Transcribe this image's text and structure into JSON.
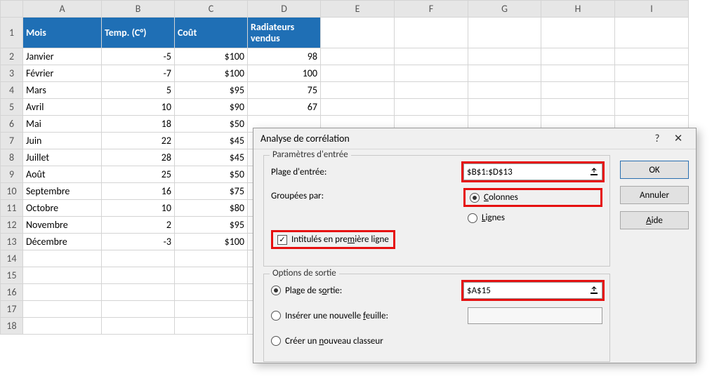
{
  "columns": [
    "A",
    "B",
    "C",
    "D",
    "E",
    "F",
    "G",
    "H",
    "I"
  ],
  "header": {
    "mois": "Mois",
    "temp": "Temp. (C°)",
    "cout": "Coût",
    "rad": "Radiateurs vendus"
  },
  "rows": [
    {
      "n": 2,
      "mois": "Janvier",
      "temp": "-5",
      "cout": "$100",
      "rad": "98"
    },
    {
      "n": 3,
      "mois": "Février",
      "temp": "-7",
      "cout": "$100",
      "rad": "100"
    },
    {
      "n": 4,
      "mois": "Mars",
      "temp": "5",
      "cout": "$95",
      "rad": "75"
    },
    {
      "n": 5,
      "mois": "Avril",
      "temp": "10",
      "cout": "$90",
      "rad": "67"
    },
    {
      "n": 6,
      "mois": "Mai",
      "temp": "18",
      "cout": "$50",
      "rad": ""
    },
    {
      "n": 7,
      "mois": "Juin",
      "temp": "22",
      "cout": "$45",
      "rad": ""
    },
    {
      "n": 8,
      "mois": "Juillet",
      "temp": "28",
      "cout": "$45",
      "rad": ""
    },
    {
      "n": 9,
      "mois": "Août",
      "temp": "25",
      "cout": "$50",
      "rad": ""
    },
    {
      "n": 10,
      "mois": "Septembre",
      "temp": "16",
      "cout": "$75",
      "rad": ""
    },
    {
      "n": 11,
      "mois": "Octobre",
      "temp": "10",
      "cout": "$80",
      "rad": ""
    },
    {
      "n": 12,
      "mois": "Novembre",
      "temp": "2",
      "cout": "$95",
      "rad": ""
    },
    {
      "n": 13,
      "mois": "Décembre",
      "temp": "-3",
      "cout": "$100",
      "rad": ""
    },
    {
      "n": 14
    },
    {
      "n": 15
    },
    {
      "n": 16
    },
    {
      "n": 17
    },
    {
      "n": 18
    }
  ],
  "dialog": {
    "title": "Analyse de corrélation",
    "group_input": "Paramètres d'entrée",
    "label_range": "Plage d'entrée:",
    "value_range": "$B$1:$D$13",
    "label_group": "Groupées par:",
    "opt_cols_pre": "",
    "opt_cols_u": "C",
    "opt_cols_post": "olonnes",
    "opt_rows_pre": "",
    "opt_rows_u": "L",
    "opt_rows_post": "ignes",
    "chk_labels_pre": "Intitulés en pre",
    "chk_labels_u": "m",
    "chk_labels_post": "ière ligne",
    "group_output": "Options de sortie",
    "opt_outrange_pre": "Plage de s",
    "opt_outrange_u": "o",
    "opt_outrange_post": "rtie:",
    "value_outrange": "$A$15",
    "opt_newsheet_pre": "Insérer une nouvelle ",
    "opt_newsheet_u": "f",
    "opt_newsheet_post": "euille:",
    "opt_newbook_pre": "Créer un ",
    "opt_newbook_u": "n",
    "opt_newbook_post": "ouveau classeur",
    "btn_ok": "OK",
    "btn_cancel": "Annuler",
    "btn_help_pre": "",
    "btn_help_u": "A",
    "btn_help_post": "ide"
  }
}
